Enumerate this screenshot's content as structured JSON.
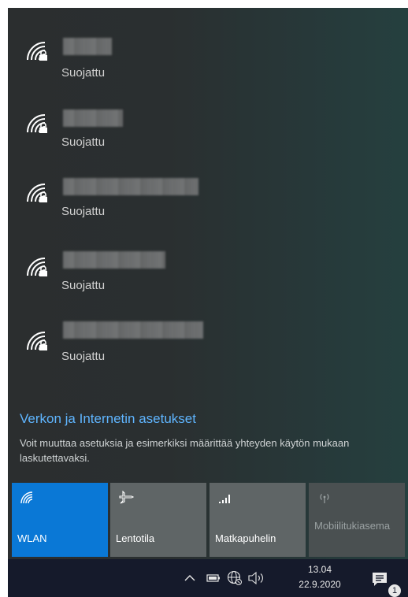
{
  "networks": [
    {
      "name": "",
      "status": "Suojattu",
      "icon": "wifi-secured-icon"
    },
    {
      "name": "",
      "status": "Suojattu",
      "icon": "wifi-secured-icon"
    },
    {
      "name": "",
      "status": "Suojattu",
      "icon": "wifi-secured-icon"
    },
    {
      "name": "",
      "status": "Suojattu",
      "icon": "wifi-secured-icon"
    },
    {
      "name": "",
      "status": "Suojattu",
      "icon": "wifi-secured-icon"
    }
  ],
  "settings": {
    "link_label": "Verkon ja Internetin asetukset",
    "description": "Voit muuttaa asetuksia ja esimerkiksi määrittää yhteyden käytön mukaan laskutettavaksi."
  },
  "quick_actions": [
    {
      "label": "WLAN",
      "icon": "wifi-icon",
      "state": "on",
      "color": "#0a78d6"
    },
    {
      "label": "Lentotila",
      "icon": "airplane-icon",
      "state": "off",
      "color": "#5f6566"
    },
    {
      "label": "Matkapuhelin",
      "icon": "cellular-icon",
      "state": "off",
      "color": "#5f6566"
    },
    {
      "label": "Mobiilitukiasema",
      "icon": "mobile-hotspot-icon",
      "state": "disabled",
      "color": "#4a5051"
    }
  ],
  "taskbar": {
    "time": "13.04",
    "date": "22.9.2020",
    "notification_count": "1",
    "icons": [
      "chevron-up-icon",
      "battery-icon",
      "network-globe-icon",
      "volume-icon",
      "action-center-icon"
    ]
  },
  "colors": {
    "accent": "#0a78d6",
    "link": "#5fb5ff",
    "taskbar": "#151a2b"
  }
}
